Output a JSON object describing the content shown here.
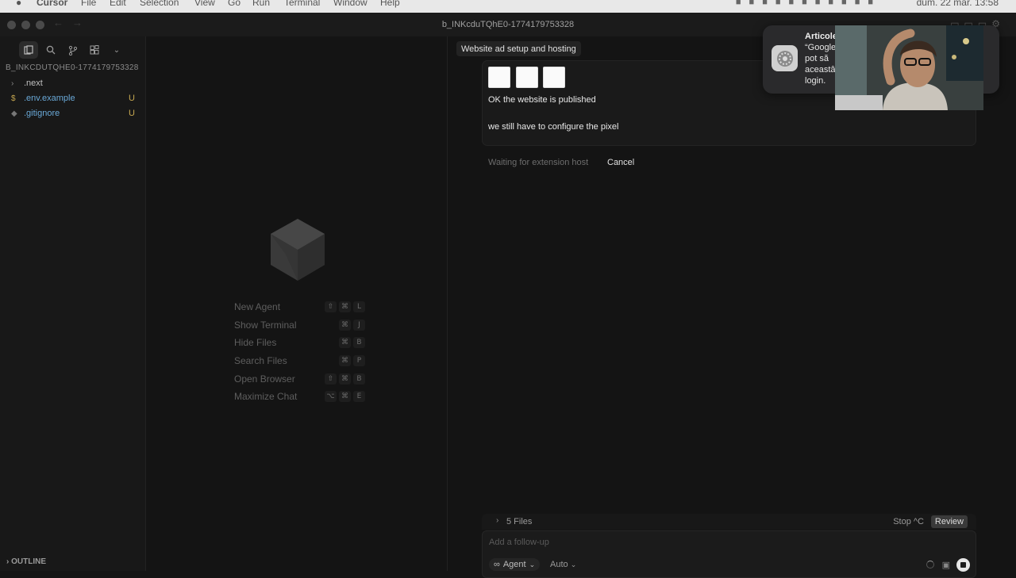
{
  "menubar": {
    "app": "Cursor",
    "items": [
      "File",
      "Edit",
      "Selection",
      "View",
      "Go",
      "Run",
      "Terminal",
      "Window",
      "Help"
    ],
    "clock": "dum. 22 mar. 13:58"
  },
  "window": {
    "title": "b_INKcduTQhE0-1774179753328"
  },
  "sidebar": {
    "project": "B_INKCDUTQHE0-1774179753328",
    "files": [
      {
        "name": ".next",
        "icon": "chevron-right",
        "badge": ""
      },
      {
        "name": ".env.example",
        "icon": "dollar",
        "badge": "U"
      },
      {
        "name": ".gitignore",
        "icon": "diamond",
        "badge": "U"
      }
    ],
    "outline": "OUTLINE"
  },
  "editor": {
    "shortcuts": [
      {
        "label": "New Agent",
        "keys": [
          "⇧",
          "⌘",
          "L"
        ]
      },
      {
        "label": "Show Terminal",
        "keys": [
          "⌘",
          "J"
        ]
      },
      {
        "label": "Hide Files",
        "keys": [
          "⌘",
          "B"
        ]
      },
      {
        "label": "Search Files",
        "keys": [
          "⌘",
          "P"
        ]
      },
      {
        "label": "Open Browser",
        "keys": [
          "⇧",
          "⌘",
          "B"
        ]
      },
      {
        "label": "Maximize Chat",
        "keys": [
          "⌥",
          "⌘",
          "E"
        ]
      }
    ]
  },
  "chat": {
    "title": "Website ad setup and hosting",
    "message_line1": "OK the website is published",
    "message_line2": "we still have to configure the pixel",
    "waiting": "Waiting for extension host",
    "cancel": "Cancel",
    "files_count": "5 Files",
    "stop": "Stop ^C",
    "review": "Review",
    "composer_placeholder": "Add a follow-up",
    "mode": "Agent",
    "model": "Auto"
  },
  "notification": {
    "title": "Articole",
    "line1": "“Google",
    "line2": "pot să",
    "line3": "aceastâ",
    "line4": "login."
  },
  "colors": {
    "accent_git": "#6aa9d8",
    "badge_untracked": "#c7a850",
    "background": "#141414"
  }
}
